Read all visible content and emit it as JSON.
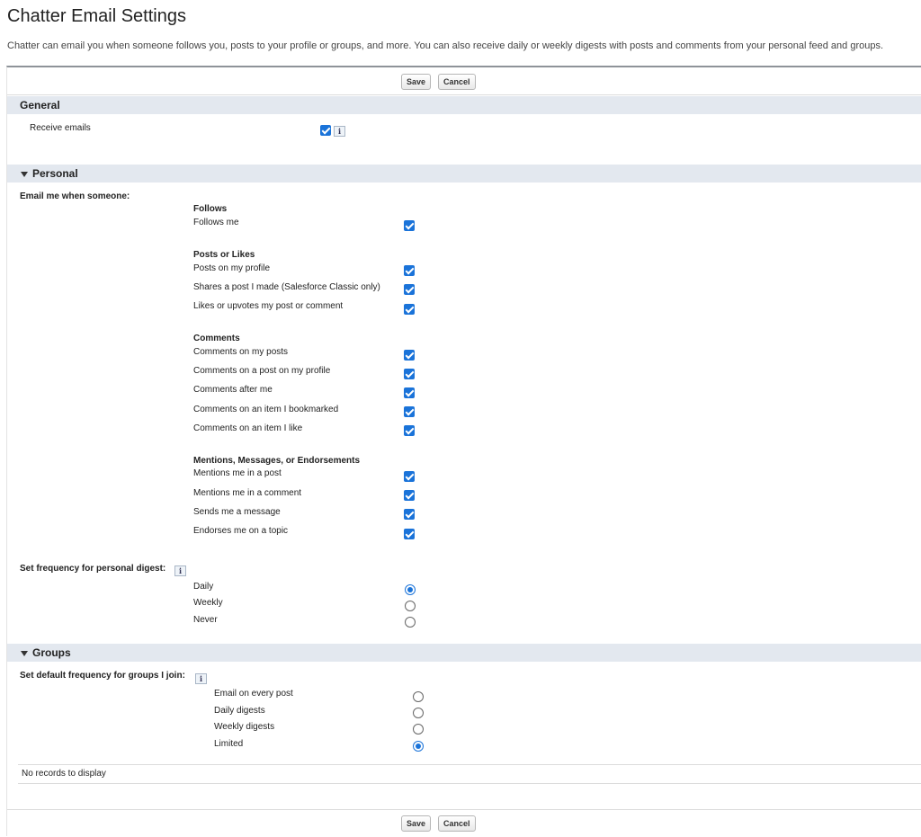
{
  "page": {
    "title": "Chatter Email Settings",
    "description": "Chatter can email you when someone follows you, posts to your profile or groups, and more. You can also receive daily or weekly digests with posts and comments from your personal feed and groups."
  },
  "buttons": {
    "save": "Save",
    "cancel": "Cancel"
  },
  "general": {
    "heading": "General",
    "receive_emails_label": "Receive emails",
    "receive_emails_checked": true,
    "info_glyph": "i"
  },
  "personal": {
    "heading": "Personal",
    "email_me_label": "Email me when someone:",
    "groups": [
      {
        "heading": "Follows",
        "items": [
          {
            "label": "Follows me",
            "checked": true
          }
        ]
      },
      {
        "heading": "Posts or Likes",
        "items": [
          {
            "label": "Posts on my profile",
            "checked": true
          },
          {
            "label": "Shares a post I made (Salesforce Classic only)",
            "checked": true
          },
          {
            "label": "Likes or upvotes my post or comment",
            "checked": true
          }
        ]
      },
      {
        "heading": "Comments",
        "items": [
          {
            "label": "Comments on my posts",
            "checked": true
          },
          {
            "label": "Comments on a post on my profile",
            "checked": true
          },
          {
            "label": "Comments after me",
            "checked": true
          },
          {
            "label": "Comments on an item I bookmarked",
            "checked": true
          },
          {
            "label": "Comments on an item I like",
            "checked": true
          }
        ]
      },
      {
        "heading": "Mentions, Messages, or Endorsements",
        "items": [
          {
            "label": "Mentions me in a post",
            "checked": true
          },
          {
            "label": "Mentions me in a comment",
            "checked": true
          },
          {
            "label": "Sends me a message",
            "checked": true
          },
          {
            "label": "Endorses me on a topic",
            "checked": true
          }
        ]
      }
    ],
    "digest_label": "Set frequency for personal digest:",
    "digest_options": [
      {
        "label": "Daily",
        "selected": true
      },
      {
        "label": "Weekly",
        "selected": false
      },
      {
        "label": "Never",
        "selected": false
      }
    ]
  },
  "groups": {
    "heading": "Groups",
    "default_label": "Set default frequency for groups I join:",
    "options": [
      {
        "label": "Email on every post",
        "selected": false
      },
      {
        "label": "Daily digests",
        "selected": false
      },
      {
        "label": "Weekly digests",
        "selected": false
      },
      {
        "label": "Limited",
        "selected": true
      }
    ],
    "no_records": "No records to display"
  },
  "colors": {
    "accent": "#1a73d9",
    "section_bg": "#e3e8ef"
  }
}
